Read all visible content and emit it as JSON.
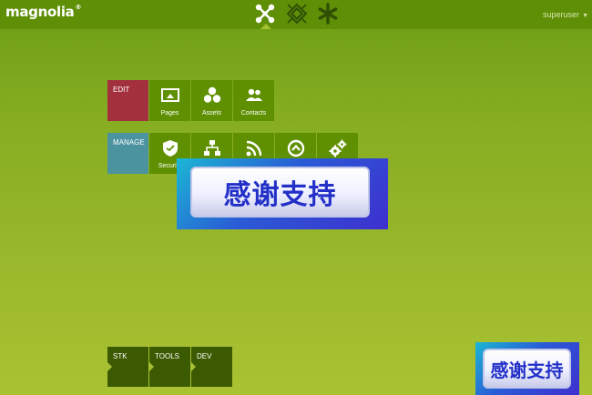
{
  "app": {
    "logo": "magnolia",
    "logo_mark": "®",
    "user": "superuser",
    "user_caret": "▼"
  },
  "top_nav": [
    {
      "name": "apps-icon"
    },
    {
      "name": "pulse-icon"
    },
    {
      "name": "favorites-icon"
    }
  ],
  "edit": {
    "title": "EDIT",
    "items": [
      {
        "label": "Pages",
        "icon": "pages-icon"
      },
      {
        "label": "Assets",
        "icon": "assets-icon"
      },
      {
        "label": "Contacts",
        "icon": "contacts-icon"
      }
    ]
  },
  "manage": {
    "title": "MANAGE",
    "items": [
      {
        "label": "Security",
        "icon": "security-icon"
      },
      {
        "label": "",
        "icon": "hierarchy-icon"
      },
      {
        "label": "",
        "icon": "rss-icon"
      },
      {
        "label": "",
        "icon": "scheduler-icon"
      },
      {
        "label": "",
        "icon": "gears-icon"
      }
    ]
  },
  "dev": {
    "groups": [
      "STK",
      "TOOLS",
      "DEV"
    ]
  },
  "overlay": {
    "big_text": "感谢支持",
    "small_text": "感谢支持"
  },
  "colors": {
    "topbar": "#5e8f06",
    "tile": "#5f9002",
    "edit": "#a3313d",
    "manage": "#4c93a0",
    "dev_tile": "#3b5a02"
  }
}
